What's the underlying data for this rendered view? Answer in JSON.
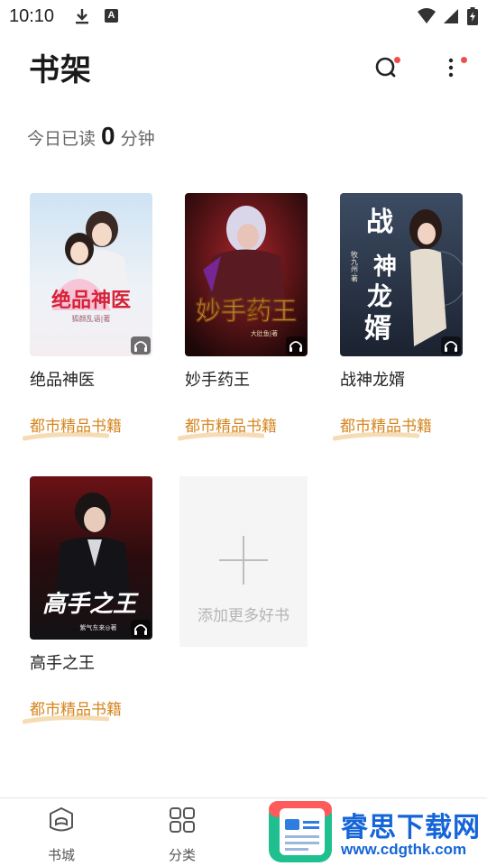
{
  "status_bar": {
    "time": "10:10"
  },
  "header": {
    "title": "书架"
  },
  "today_read": {
    "prefix": "今日已读",
    "count": "0",
    "unit": "分钟"
  },
  "books": [
    {
      "title": "绝品神医",
      "tag": "都市精品书籍",
      "cover_title": "绝品神医",
      "cover_subtitle": "狐颜乱语|著"
    },
    {
      "title": "妙手药王",
      "tag": "都市精品书籍",
      "cover_title": "妙手药王",
      "cover_subtitle": "大肚鱼|著"
    },
    {
      "title": "战神龙婿",
      "tag": "都市精品书籍",
      "cover_title": "战神龙婿",
      "cover_subtitle": "牧九州·著"
    },
    {
      "title": "高手之王",
      "tag": "都市精品书籍",
      "cover_title": "高手之王",
      "cover_subtitle": "紫气东来◎著"
    }
  ],
  "add_book": {
    "label": "添加更多好书"
  },
  "bottom_nav": [
    {
      "label": "书城",
      "icon": "bookstore-icon"
    },
    {
      "label": "分类",
      "icon": "category-grid-icon"
    }
  ],
  "watermark": {
    "title": "睿思下载网",
    "url": "www.cdgthk.com"
  },
  "colors": {
    "tag": "#d5861f",
    "red_dot": "#f04e4e",
    "watermark": "#1565d8"
  }
}
